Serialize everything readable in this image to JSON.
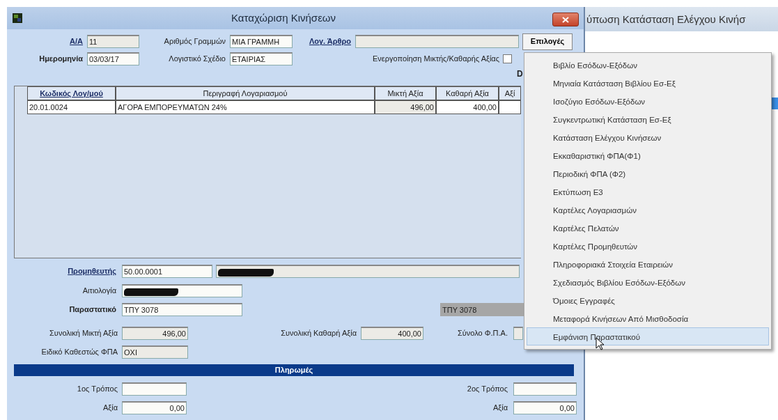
{
  "window": {
    "title": "Καταχώριση Κινήσεων"
  },
  "top_rows": [
    [
      {
        "label": "Α/Α",
        "kind": "link",
        "value": "11",
        "readonly": true
      },
      {
        "label": "Αριθμός Γραμμών",
        "kind": "plain",
        "value": "ΜΙΑ ΓΡΑΜΜΗ",
        "readonly": false
      },
      {
        "label": "Λογ. Άρθρο",
        "kind": "link",
        "readonly": true
      }
    ],
    [
      {
        "label": "Ημερομηνία",
        "kind": "bold",
        "value": "03/03/17",
        "readonly": false
      },
      {
        "label": "Λογιστικό Σχέδιο",
        "kind": "plain",
        "value": "ΕΤΑΙΡΙΑΣ",
        "readonly": false
      }
    ]
  ],
  "options_button": "Επιλογές",
  "gross_net_toggle": {
    "label": "Ενεργοποίηση Μικτής/Καθαρής Αξίας",
    "checked": false
  },
  "cut_label": "D",
  "table": {
    "columns": [
      {
        "label": "Κωδικός Λογ/μού",
        "kind": "link"
      },
      {
        "label": "Περιγραφή Λογαριασμού",
        "kind": "plain"
      },
      {
        "label": "Μικτή Αξία",
        "kind": "plain"
      },
      {
        "label": "Καθαρή Αξία",
        "kind": "plain"
      },
      {
        "label": "Αξί",
        "kind": "plain"
      }
    ],
    "rows": [
      {
        "cells": [
          "20.01.0024",
          "ΑΓΟΡΑ ΕΜΠΟΡΕΥΜΑΤΩΝ 24%",
          "496,00",
          "400,00"
        ]
      }
    ]
  },
  "supplier": {
    "label": "Προμηθευτής",
    "value": "50.00.0001",
    "name_redacted": true
  },
  "reason": {
    "label": "Αιτιολογία",
    "redacted": true
  },
  "document": {
    "label": "Παραστατικό",
    "value": "ΤΠΥ 3078",
    "echo": "ΤΠΥ 3078"
  },
  "totals": [
    {
      "label": "Συνολική Μικτή Αξία",
      "value": "496,00"
    },
    {
      "label": "Συνολική Καθαρή Αξία",
      "value": "400,00"
    },
    {
      "label": "Σύνολο Φ.Π.Α."
    }
  ],
  "vat_status": {
    "label": "Ειδικό Καθεστώς ΦΠΑ",
    "value": "ΟΧΙ"
  },
  "payments": {
    "title": "Πληρωμές",
    "methods": [
      {
        "method_label": "1ος Τρόπος",
        "amount_label": "Αξία",
        "amount": "0,00"
      },
      {
        "method_label": "2ος Τρόπος",
        "amount_label": "Αξία",
        "amount": "0,00"
      }
    ]
  },
  "background_window": {
    "title": "ύπωση Κατάσταση Ελέγχου Κινήσ"
  },
  "menu": [
    {
      "label": "Βιβλίο Εσόδων-Εξόδων",
      "selected": false
    },
    {
      "label": "Μηνιαία Κατάσταση Βιβλίου Εσ-Εξ",
      "selected": false
    },
    {
      "label": "Ισοζύγιο Εσόδων-Εξόδων",
      "selected": false
    },
    {
      "label": "Συγκεντρωτική Κατάσταση Εσ-Εξ",
      "selected": false
    },
    {
      "label": "Κατάσταση Ελέγχου Κινήσεων",
      "selected": false
    },
    {
      "label": "Εκκαθαριστική ΦΠΑ(Φ1)",
      "selected": false
    },
    {
      "label": "Περιοδική ΦΠΑ (Φ2)",
      "selected": false
    },
    {
      "label": "Εκτύπωση Ε3",
      "selected": false
    },
    {
      "label": "Καρτέλες Λογαριασμών",
      "selected": false
    },
    {
      "label": "Καρτέλες Πελατών",
      "selected": false
    },
    {
      "label": "Καρτέλες Προμηθευτών",
      "selected": false
    },
    {
      "label": "Πληροφοριακά Στοιχεία Εταιρειών",
      "selected": false
    },
    {
      "label": "Σχεδιασμός Βιβλίου Εσόδων-Εξόδων",
      "selected": false
    },
    {
      "label": "Όμοιες Εγγραφές",
      "selected": false
    },
    {
      "label": "Μεταφορά Κινήσεων Από Μισθοδοσία",
      "selected": false
    },
    {
      "label": "Εμφάνιση Παραστατικού",
      "selected": true
    }
  ]
}
